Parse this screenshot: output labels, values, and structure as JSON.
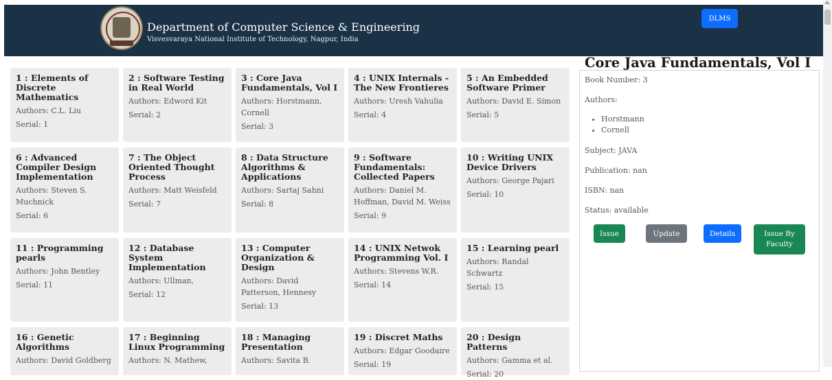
{
  "header": {
    "title": "Department of Computer Science & Engineering",
    "subtitle": "Visvesvaraya National Institute of Technology, Nagpur, India",
    "dlms_label": "DLMS"
  },
  "books": [
    {
      "title": "1 : Elements of Discrete Mathematics",
      "authors": "Authors: C.L. Liu",
      "serial": "Serial: 1"
    },
    {
      "title": "2 : Software Testing in Real World",
      "authors": "Authors: Edword Kit",
      "serial": "Serial: 2"
    },
    {
      "title": "3 : Core Java Fundamentals, Vol I",
      "authors": "Authors: Horstmann, Cornell",
      "serial": "Serial: 3"
    },
    {
      "title": "4 : UNIX Internals - The New Frontieres",
      "authors": "Authors: Uresh Vahulia",
      "serial": "Serial: 4"
    },
    {
      "title": "5 : An Embedded Software Primer",
      "authors": "Authors: David E. Simon",
      "serial": "Serial: 5"
    },
    {
      "title": "6 : Advanced Compiler Design Implementation",
      "authors": "Authors: Steven S. Muchnick",
      "serial": "Serial: 6"
    },
    {
      "title": "7 : The Object Oriented Thought Process",
      "authors": "Authors: Matt Weisfeld",
      "serial": "Serial: 7"
    },
    {
      "title": "8 : Data Structure Algorithms & Applications",
      "authors": "Authors: Sartaj Sahni",
      "serial": "Serial: 8"
    },
    {
      "title": "9 : Software Fundamentals: Collected Papers",
      "authors": "Authors: Daniel M. Hoffman, David M. Weiss",
      "serial": "Serial: 9"
    },
    {
      "title": "10 : Writing UNIX Device Drivers",
      "authors": "Authors: George Pajari",
      "serial": "Serial: 10"
    },
    {
      "title": "11 : Programming pearls",
      "authors": "Authors: John Bentley",
      "serial": "Serial: 11"
    },
    {
      "title": "12 : Database System Implementation",
      "authors": "Authors: Ullman,",
      "serial": "Serial: 12"
    },
    {
      "title": "13 : Computer Organization & Design",
      "authors": "Authors: David Patterson, Hennesy",
      "serial": "Serial: 13"
    },
    {
      "title": "14 : UNIX Netwok Programming Vol. I",
      "authors": "Authors: Stevens W.R.",
      "serial": "Serial: 14"
    },
    {
      "title": "15 : Learning pearl",
      "authors": "Authors: Randal Schwartz",
      "serial": "Serial: 15"
    },
    {
      "title": "16 : Genetic Algorithms",
      "authors": "Authors: David Goldberg",
      "serial": ""
    },
    {
      "title": "17 : Beginning Linux Programming",
      "authors": "Authors: N. Mathew,",
      "serial": ""
    },
    {
      "title": "18 : Managing Presentation",
      "authors": "Authors: Savita B.",
      "serial": ""
    },
    {
      "title": "19 : Discret Maths",
      "authors": "Authors: Edgar Goodaire",
      "serial": "Serial: 19"
    },
    {
      "title": "20 : Design Patterns",
      "authors": "Authors: Gamma et al.",
      "serial": "Serial: 20"
    }
  ],
  "detail": {
    "title": "Core Java Fundamentals, Vol I",
    "book_number": "Book Number: 3",
    "authors_label": "Authors:",
    "authors": [
      "Horstmann",
      "Cornell"
    ],
    "subject": "Subject: JAVA",
    "publication": "Publication: nan",
    "isbn": "ISBN: nan",
    "status": "Status: available",
    "buttons": {
      "issue": "Issue",
      "update": "Update",
      "details": "Details",
      "issue_by_faculty": "Issue By Faculty"
    }
  },
  "colors": {
    "header_bg": "#1b3146",
    "primary": "#0d6efd",
    "success": "#198754",
    "secondary": "#6c757d",
    "card_bg": "#ececec"
  }
}
